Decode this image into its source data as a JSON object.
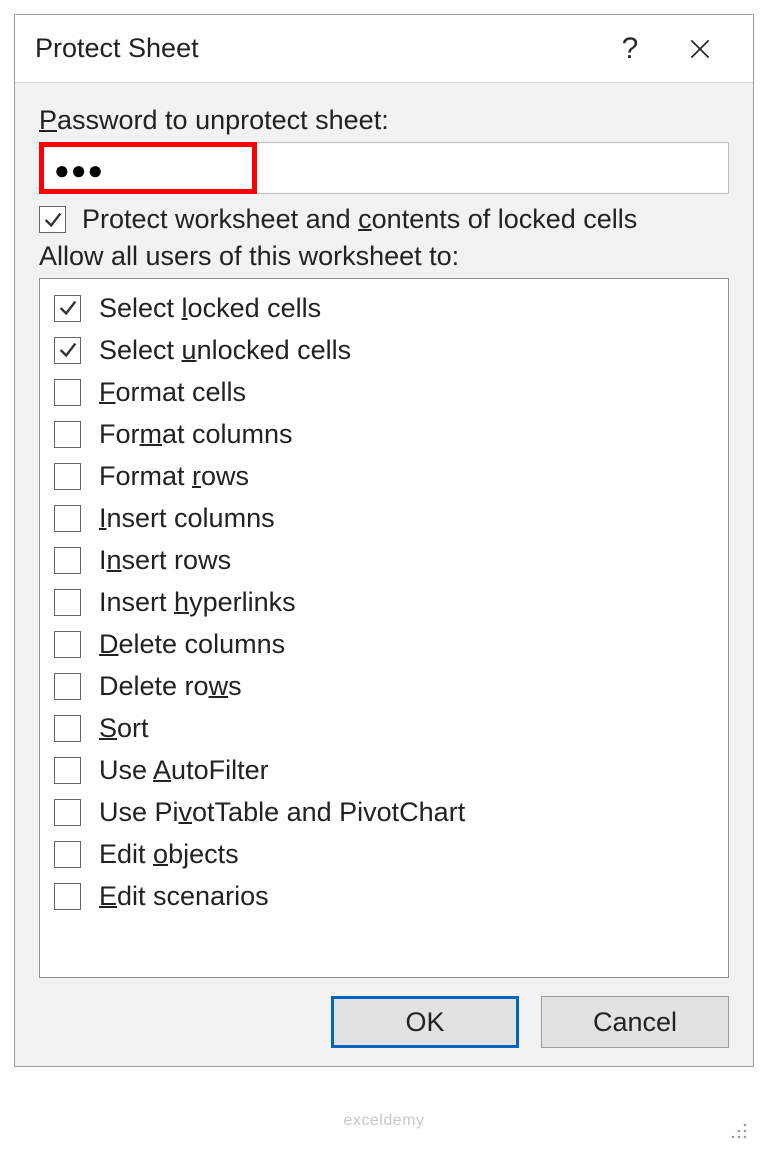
{
  "title": "Protect Sheet",
  "password_label_pre": "P",
  "password_label_post": "assword to unprotect sheet:",
  "password_value": "●●●",
  "protect_checkbox": {
    "checked": true,
    "pre": "Protect worksheet and ",
    "u": "c",
    "post": "ontents of locked cells"
  },
  "allow_label": "Allow all users of this worksheet to:",
  "options": [
    {
      "checked": true,
      "pre": "Select ",
      "u": "l",
      "post": "ocked cells"
    },
    {
      "checked": true,
      "pre": "Select ",
      "u": "u",
      "post": "nlocked cells"
    },
    {
      "checked": false,
      "pre": "",
      "u": "F",
      "post": "ormat cells"
    },
    {
      "checked": false,
      "pre": "For",
      "u": "m",
      "post": "at columns"
    },
    {
      "checked": false,
      "pre": "Format ",
      "u": "r",
      "post": "ows"
    },
    {
      "checked": false,
      "pre": "",
      "u": "I",
      "post": "nsert columns"
    },
    {
      "checked": false,
      "pre": "I",
      "u": "n",
      "post": "sert rows"
    },
    {
      "checked": false,
      "pre": "Insert ",
      "u": "h",
      "post": "yperlinks"
    },
    {
      "checked": false,
      "pre": "",
      "u": "D",
      "post": "elete columns"
    },
    {
      "checked": false,
      "pre": "Delete ro",
      "u": "w",
      "post": "s"
    },
    {
      "checked": false,
      "pre": "",
      "u": "S",
      "post": "ort"
    },
    {
      "checked": false,
      "pre": "Use ",
      "u": "A",
      "post": "utoFilter"
    },
    {
      "checked": false,
      "pre": "Use Pi",
      "u": "v",
      "post": "otTable and PivotChart"
    },
    {
      "checked": false,
      "pre": "Edit ",
      "u": "o",
      "post": "bjects"
    },
    {
      "checked": false,
      "pre": "",
      "u": "E",
      "post": "dit scenarios"
    }
  ],
  "buttons": {
    "ok": "OK",
    "cancel": "Cancel"
  },
  "watermark": "exceldemy"
}
